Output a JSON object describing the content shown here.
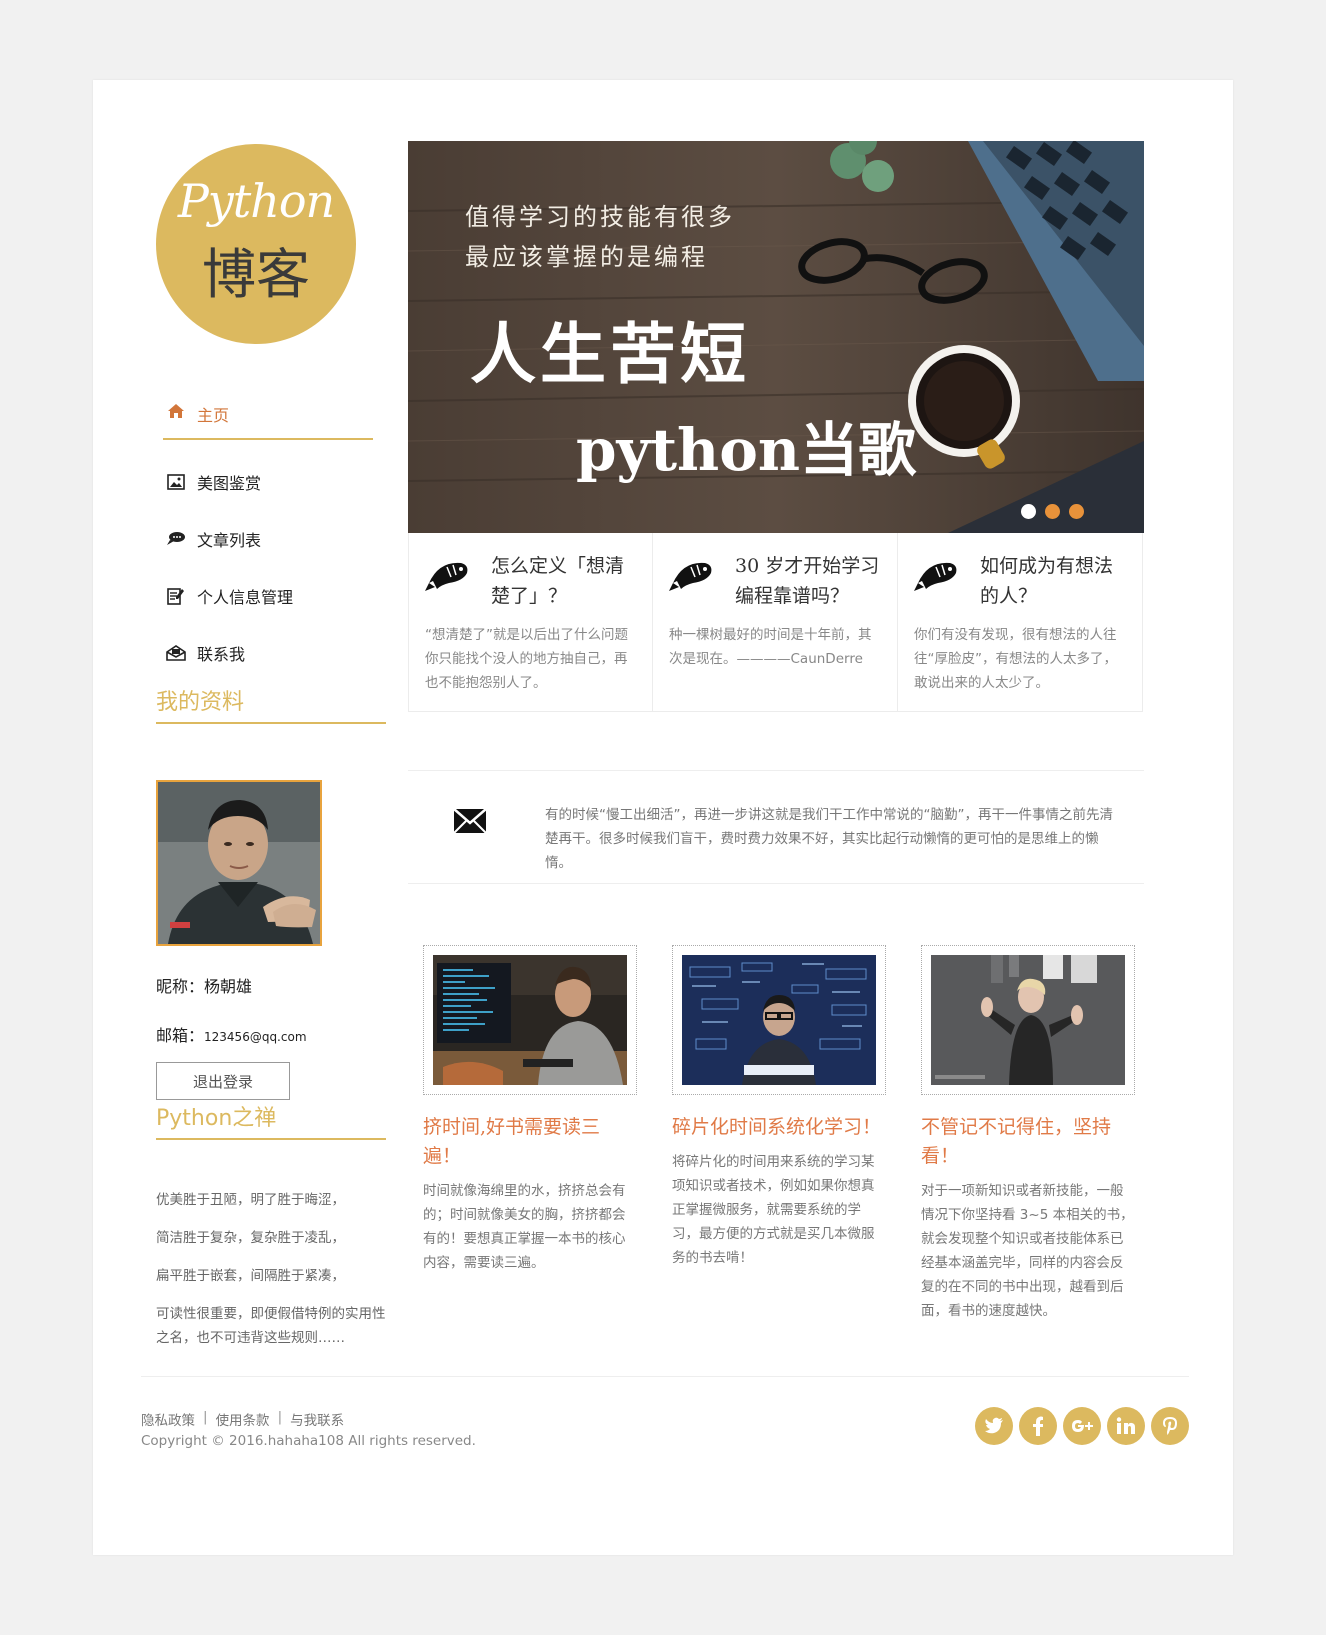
{
  "logo": {
    "line1": "Python",
    "line2": "博客"
  },
  "nav": {
    "items": [
      {
        "label": "主页",
        "icon": "home-icon",
        "active": true
      },
      {
        "label": "美图鉴赏",
        "icon": "image-icon"
      },
      {
        "label": "文章列表",
        "icon": "chat-bubble-icon"
      },
      {
        "label": "个人信息管理",
        "icon": "edit-note-icon"
      },
      {
        "label": "联系我",
        "icon": "mail-open-icon"
      }
    ]
  },
  "profile": {
    "heading": "我的资料",
    "nickname_label": "昵称：",
    "nickname": "杨朝雄",
    "email_label": "邮箱：",
    "email": "123456@qq.com",
    "logout": "退出登录"
  },
  "zen": {
    "heading": "Python之禅",
    "lines": [
      "优美胜于丑陋，明了胜于晦涩，",
      "简洁胜于复杂，复杂胜于凌乱，",
      "扁平胜于嵌套，间隔胜于紧凑，",
      "可读性很重要，即便假借特例的实用性之名，也不可违背这些规则……"
    ]
  },
  "banner": {
    "line1": "值得学习的技能有很多",
    "line2": "最应该掌握的是编程",
    "slogan": "人生苦短",
    "slogan2": "python当歌",
    "slides": 3,
    "active_slide": 1
  },
  "features": [
    {
      "title": "怎么定义「想清楚了」？",
      "desc": "“想清楚了”就是以后出了什么问题你只能找个没人的地方抽自己，再也不能抱怨别人了。"
    },
    {
      "title": "30 岁才开始学习编程靠谱吗？",
      "desc": "种一棵树最好的时间是十年前，其次是现在。————CaunDerre"
    },
    {
      "title": "如何成为有想法的人？",
      "desc": "你们有没有发现，很有想法的人往往“厚脸皮”，有想法的人太多了，敢说出来的人太少了。"
    }
  ],
  "quote": {
    "text": "有的时候“慢工出细活”，再进一步讲这就是我们干工作中常说的“脑勤”，再干一件事情之前先清楚再干。很多时候我们盲干，费时费力效果不好，其实比起行动懒惰的更可怕的是思维上的懒惰。"
  },
  "articles": [
    {
      "title": "挤时间,好书需要读三遍！",
      "desc": "时间就像海绵里的水，挤挤总会有的；时间就像美女的胸，挤挤都会有的！要想真正掌握一本书的核心内容，需要读三遍。"
    },
    {
      "title": "碎片化时间系统化学习！",
      "desc": "将碎片化的时间用来系统的学习某项知识或者技术，例如如果你想真正掌握微服务，就需要系统的学习，最方便的方式就是买几本微服务的书去啃！"
    },
    {
      "title": "不管记不记得住，坚持看！",
      "desc": "对于一项新知识或者新技能，一般情况下你坚持看 3~5 本相关的书，就会发现整个知识或者技能体系已经基本涵盖完毕，同样的内容会反复的在不同的书中出现，越看到后面，看书的速度越快。"
    }
  ],
  "footer": {
    "links": [
      "隐私政策",
      "使用条款",
      "与我联系"
    ],
    "separator": "|",
    "copyright": "Copyright © 2016.hahaha108 All rights reserved.",
    "socials": [
      "twitter-icon",
      "facebook-icon",
      "google-plus-icon",
      "linkedin-icon",
      "pinterest-icon"
    ]
  },
  "colors": {
    "gold": "#dcb95f",
    "accent_orange": "#e07a47",
    "nav_active": "#d2763a"
  }
}
